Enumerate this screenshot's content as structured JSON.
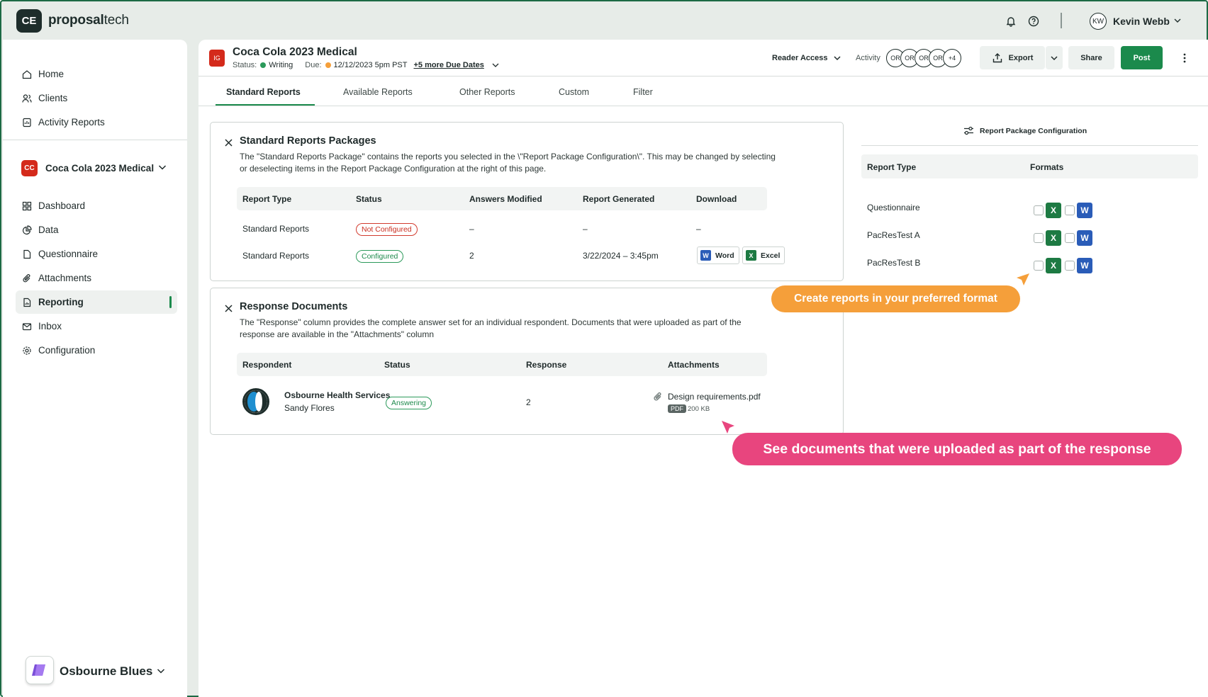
{
  "app": {
    "logo_mark": "CE",
    "brand_bold": "proposal",
    "brand_light": "tech"
  },
  "user": {
    "initials": "KW",
    "name": "Kevin Webb"
  },
  "sidebar": {
    "top_items": [
      {
        "label": "Home"
      },
      {
        "label": "Clients"
      },
      {
        "label": "Activity Reports"
      }
    ],
    "project": {
      "badge": "CC",
      "name": "Coca Cola 2023 Medical"
    },
    "project_items": [
      {
        "label": "Dashboard"
      },
      {
        "label": "Data"
      },
      {
        "label": "Questionnaire"
      },
      {
        "label": "Attachments"
      },
      {
        "label": "Reporting"
      },
      {
        "label": "Inbox"
      },
      {
        "label": "Configuration"
      }
    ],
    "active_item": "Reporting",
    "org": {
      "name": "Osbourne Blues"
    }
  },
  "header": {
    "badge": "IG",
    "title": "Coca Cola 2023 Medical",
    "status_label": "Status:",
    "status_value": "Writing",
    "due_label": "Due:",
    "due_value": "12/12/2023 5pm PST",
    "more_due": "+5 more Due Dates",
    "reader_access": "Reader Access",
    "activity_label": "Activity",
    "activity_avatars": [
      "OR",
      "OR",
      "OR",
      "OR",
      "+4"
    ],
    "export_label": "Export",
    "share_label": "Share",
    "post_label": "Post",
    "colors": {
      "writing": "#2c9a5b",
      "due": "#f59f3a",
      "post": "#1b8a4c"
    }
  },
  "tabs": [
    {
      "label": "Standard Reports"
    },
    {
      "label": "Available Reports"
    },
    {
      "label": "Other Reports"
    },
    {
      "label": "Custom"
    },
    {
      "label": "Filter"
    }
  ],
  "packages": {
    "title": "Standard Reports Packages",
    "description": "The \"Standard Reports Package\" contains the reports you selected in the \\\"Report Package Configuration\\\". This may be changed by selecting or deselecting items in the Report Package Configuration at the right of this page.",
    "columns": [
      "Report Type",
      "Status",
      "Answers Modified",
      "Report Generated",
      "Download"
    ],
    "rows": [
      {
        "type": "Standard Reports",
        "status": "Not Configured",
        "modified": "–",
        "generated": "–",
        "download": "–"
      },
      {
        "type": "Standard Reports",
        "status": "Configured",
        "modified": "2",
        "generated": "3/22/2024 – 3:45pm",
        "word": "Word",
        "excel": "Excel"
      }
    ]
  },
  "responses": {
    "title": "Response Documents",
    "description": "The \"Response\" column provides the complete answer set for an individual respondent. Documents that were uploaded as part of the response are available in the \"Attachments\" column",
    "columns": [
      "Respondent",
      "Status",
      "Response",
      "Attachments"
    ],
    "rows": [
      {
        "org": "Osbourne Health Services",
        "person": "Sandy Flores",
        "status": "Answering",
        "response": "2",
        "file": "Design requirements.pdf",
        "file_type": "PDF",
        "file_size": "200 KB"
      }
    ]
  },
  "config_panel": {
    "title": "Report Package Configuration",
    "columns": [
      "Report Type",
      "Formats"
    ],
    "rows": [
      {
        "label": "Questionnaire"
      },
      {
        "label": "PacResTest A"
      },
      {
        "label": "PacResTest B"
      }
    ]
  },
  "callouts": {
    "format": "Create reports in your preferred format",
    "uploads": "See documents that were uploaded as part of the response",
    "colors": {
      "orange": "#f59f3a",
      "pink": "#e8457e"
    }
  }
}
